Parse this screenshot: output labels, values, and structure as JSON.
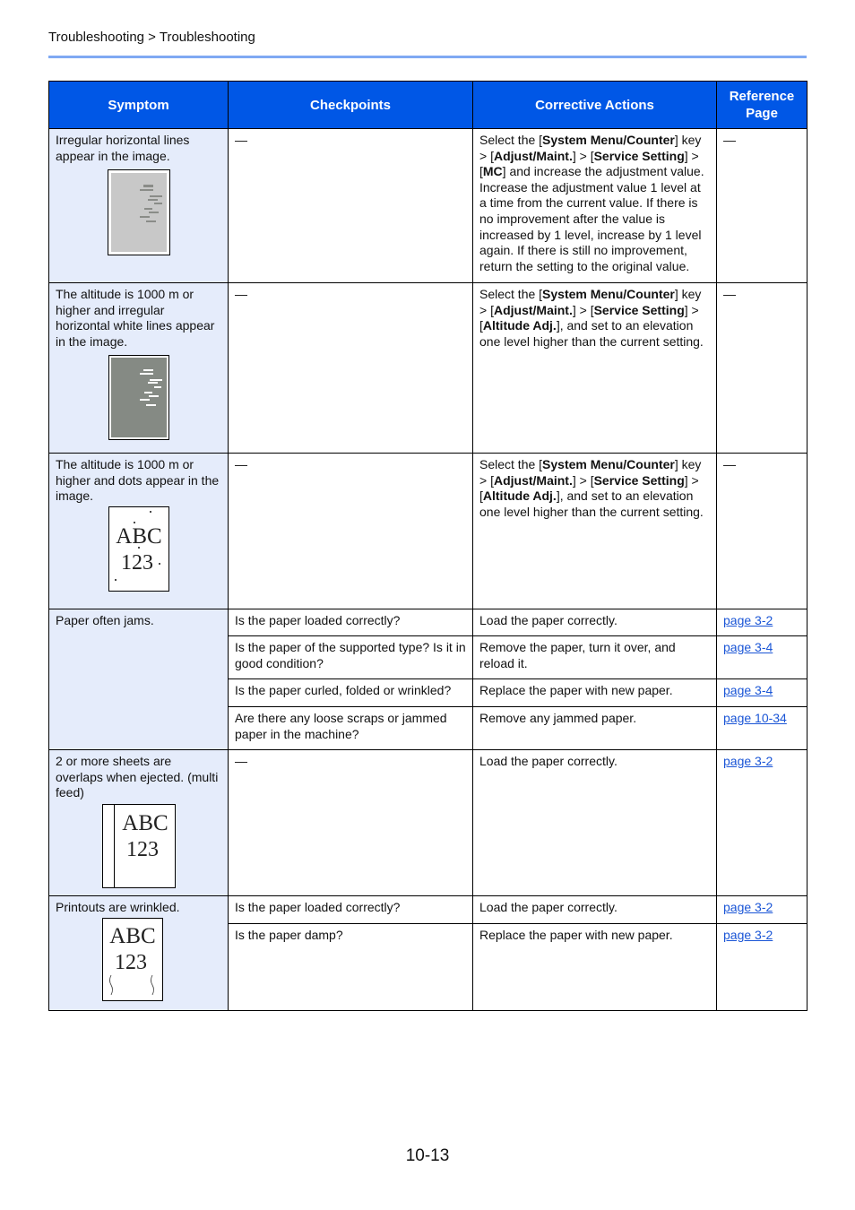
{
  "breadcrumb": "Troubleshooting > Troubleshooting",
  "colors": {
    "header_bg": "#0057e6",
    "header_text": "#ffffff",
    "symptom_bg": "#e5ecfb",
    "rule": "#7fa9f3",
    "link": "#1a55d6"
  },
  "table": {
    "headers": [
      "Symptom",
      "Checkpoints",
      "Corrective Actions",
      "Reference Page"
    ],
    "rows": [
      {
        "symptom": "Irregular horizontal lines appear in the image.",
        "illustration": "gray-page-dark-lines-icon",
        "checks": [
          {
            "checkpoint": "—",
            "action_parts": [
              {
                "t": "Select the [",
                "b": false
              },
              {
                "t": "System Menu/Counter",
                "b": true
              },
              {
                "t": "] key > [",
                "b": false
              },
              {
                "t": "Adjust/Maint.",
                "b": true
              },
              {
                "t": "] > [",
                "b": false
              },
              {
                "t": "Service Setting",
                "b": true
              },
              {
                "t": "] > [",
                "b": false
              },
              {
                "t": "MC",
                "b": true
              },
              {
                "t": "] and increase the adjustment value. Increase the adjustment value 1 level at a time from the current value. If there is no improvement after the value is increased by 1 level, increase by 1 level again. If there is still no improvement, return the setting to the original value.",
                "b": false
              }
            ],
            "ref": "—"
          }
        ]
      },
      {
        "symptom": "The altitude is 1000 m or higher and irregular horizontal white lines appear in the image.",
        "illustration": "dark-page-white-lines-icon",
        "checks": [
          {
            "checkpoint": "—",
            "action_parts": [
              {
                "t": "Select the [",
                "b": false
              },
              {
                "t": "System Menu/Counter",
                "b": true
              },
              {
                "t": "] key > [",
                "b": false
              },
              {
                "t": "Adjust/Maint.",
                "b": true
              },
              {
                "t": "] > [",
                "b": false
              },
              {
                "t": "Service Setting",
                "b": true
              },
              {
                "t": "] > [",
                "b": false
              },
              {
                "t": "Altitude Adj.",
                "b": true
              },
              {
                "t": "], and set to an elevation one level higher than the current setting.",
                "b": false
              }
            ],
            "ref": "—"
          }
        ]
      },
      {
        "symptom": "The altitude is 1000 m or higher and dots appear in the image.",
        "illustration": "page-with-dots-icon",
        "illustration_text": [
          "ABC",
          "123"
        ],
        "checks": [
          {
            "checkpoint": "—",
            "action_parts": [
              {
                "t": "Select the [",
                "b": false
              },
              {
                "t": "System Menu/Counter",
                "b": true
              },
              {
                "t": "] key > [",
                "b": false
              },
              {
                "t": "Adjust/Maint.",
                "b": true
              },
              {
                "t": "] > [",
                "b": false
              },
              {
                "t": "Service Setting",
                "b": true
              },
              {
                "t": "] > [",
                "b": false
              },
              {
                "t": "Altitude Adj.",
                "b": true
              },
              {
                "t": "], and set to an elevation one level higher than the current setting.",
                "b": false
              }
            ],
            "ref": "—"
          }
        ]
      },
      {
        "symptom": "Paper often jams.",
        "illustration": null,
        "checks": [
          {
            "checkpoint": "Is the paper loaded correctly?",
            "action": "Load the paper correctly.",
            "ref": "page 3-2"
          },
          {
            "checkpoint": "Is the paper of the supported type? Is it in good condition?",
            "action": "Remove the paper, turn it over, and reload it.",
            "ref": "page 3-4"
          },
          {
            "checkpoint": "Is the paper curled, folded or wrinkled?",
            "action": "Replace the paper with new paper.",
            "ref": "page 3-4"
          },
          {
            "checkpoint": "Are there any loose scraps or jammed paper in the machine?",
            "action": "Remove any jammed paper.",
            "ref": "page 10-34"
          }
        ]
      },
      {
        "symptom": "2 or more sheets are overlaps when ejected. (multi feed)",
        "illustration": "overlapping-sheets-icon",
        "illustration_text": [
          "ABC",
          "123"
        ],
        "checks": [
          {
            "checkpoint": "—",
            "action": "Load the paper correctly.",
            "ref": "page 3-2"
          }
        ]
      },
      {
        "symptom": "Printouts are wrinkled.",
        "illustration": "wrinkled-page-icon",
        "illustration_text": [
          "ABC",
          "123"
        ],
        "checks": [
          {
            "checkpoint": "Is the paper loaded correctly?",
            "action": "Load the paper correctly.",
            "ref": "page 3-2"
          },
          {
            "checkpoint": "Is the paper damp?",
            "action": "Replace the paper with new paper.",
            "ref": "page 3-2"
          }
        ]
      }
    ]
  },
  "page_number": "10-13"
}
